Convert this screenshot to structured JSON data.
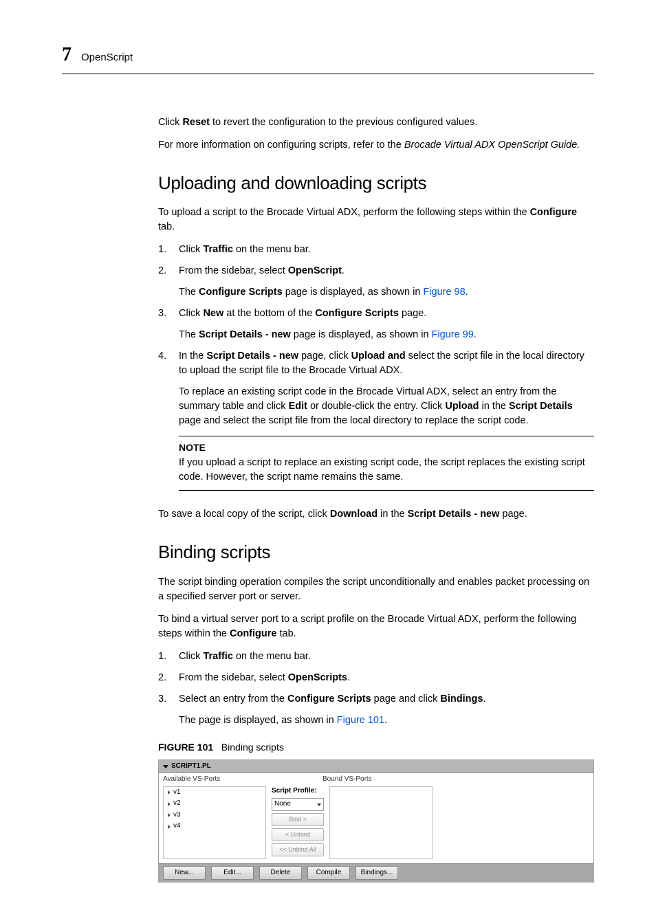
{
  "header": {
    "chapter_num": "7",
    "chapter_title": "OpenScript"
  },
  "intro": {
    "p1_a": "Click ",
    "p1_b": "Reset",
    "p1_c": " to revert the configuration to the previous configured values.",
    "p2_a": "For more information on configuring scripts, refer to the ",
    "p2_b": "Brocade Virtual ADX OpenScript Guide."
  },
  "sec1": {
    "heading": "Uploading and downloading scripts",
    "intro_a": "To upload a script to the Brocade Virtual ADX, perform the following steps within the ",
    "intro_b": "Configure",
    "intro_c": " tab.",
    "li1_a": "Click ",
    "li1_b": "Traffic",
    "li1_c": " on the menu bar.",
    "li2_a": "From the sidebar, select ",
    "li2_b": "OpenScript",
    "li2_c": ".",
    "li2s_a": "The ",
    "li2s_b": "Configure Scripts",
    "li2s_c": " page is displayed, as shown in ",
    "li2s_d": "Figure 98",
    "li2s_e": ".",
    "li3_a": "Click ",
    "li3_b": "New",
    "li3_c": " at the bottom of the ",
    "li3_d": "Configure Scripts",
    "li3_e": " page.",
    "li3s_a": "The ",
    "li3s_b": "Script Details - new",
    "li3s_c": " page is displayed, as shown in ",
    "li3s_d": "Figure 99",
    "li3s_e": ".",
    "li4_a": "In the ",
    "li4_b": "Script Details - new",
    "li4_c": " page, click ",
    "li4_d": "Upload and ",
    "li4_e": "select the script file in the local directory to upload the script file to the Brocade Virtual ADX.",
    "li4p2_a": "To replace an existing script code in the Brocade Virtual ADX, select an entry from the summary table and click ",
    "li4p2_b": "Edit",
    "li4p2_c": " or double-click the entry. Click ",
    "li4p2_d": "Upload",
    "li4p2_e": " in the ",
    "li4p2_f": "Script Details",
    "li4p2_g": " page and select the script file from the local directory to replace the script code.",
    "note_label": "NOTE",
    "note_body": "If you upload a script to replace an existing script code, the script replaces the existing script code. However, the script name remains the same.",
    "out_a": "To save a local copy of the script, click ",
    "out_b": "Download",
    "out_c": " in the ",
    "out_d": "Script Details - new",
    "out_e": " page."
  },
  "sec2": {
    "heading": "Binding scripts",
    "p1": "The script binding operation compiles the script unconditionally and enables packet processing on a specified server port or server.",
    "p2_a": "To bind a virtual server port to a script profile on the Brocade Virtual ADX, perform the following steps within the ",
    "p2_b": "Configure",
    "p2_c": " tab.",
    "li1_a": "Click ",
    "li1_b": "Traffic",
    "li1_c": " on the menu bar.",
    "li2_a": "From the sidebar, select ",
    "li2_b": "OpenScripts",
    "li2_c": ".",
    "li3_a": "Select an entry from the ",
    "li3_b": "Configure Scripts",
    "li3_c": " page and click ",
    "li3_d": "Bindings",
    "li3_e": ".",
    "li3s_a": "The page is displayed, as shown in ",
    "li3s_b": "Figure 101",
    "li3s_c": "."
  },
  "figure": {
    "caption_label": "FIGURE 101",
    "caption_text": "Binding scripts",
    "title": "SCRIPT1.PL",
    "avail_label": "Available VS-Ports",
    "bound_label": "Bound VS-Ports",
    "items": [
      "v1",
      "v2",
      "v3",
      "v4"
    ],
    "profile_label": "Script Profile:",
    "profile_value": "None",
    "btn_bind": "Bind >",
    "btn_unbind": "< Unbind",
    "btn_unbind_all": "<< Unbind All",
    "footer": [
      "New...",
      "Edit...",
      "Delete",
      "Compile",
      "Bindings..."
    ]
  }
}
